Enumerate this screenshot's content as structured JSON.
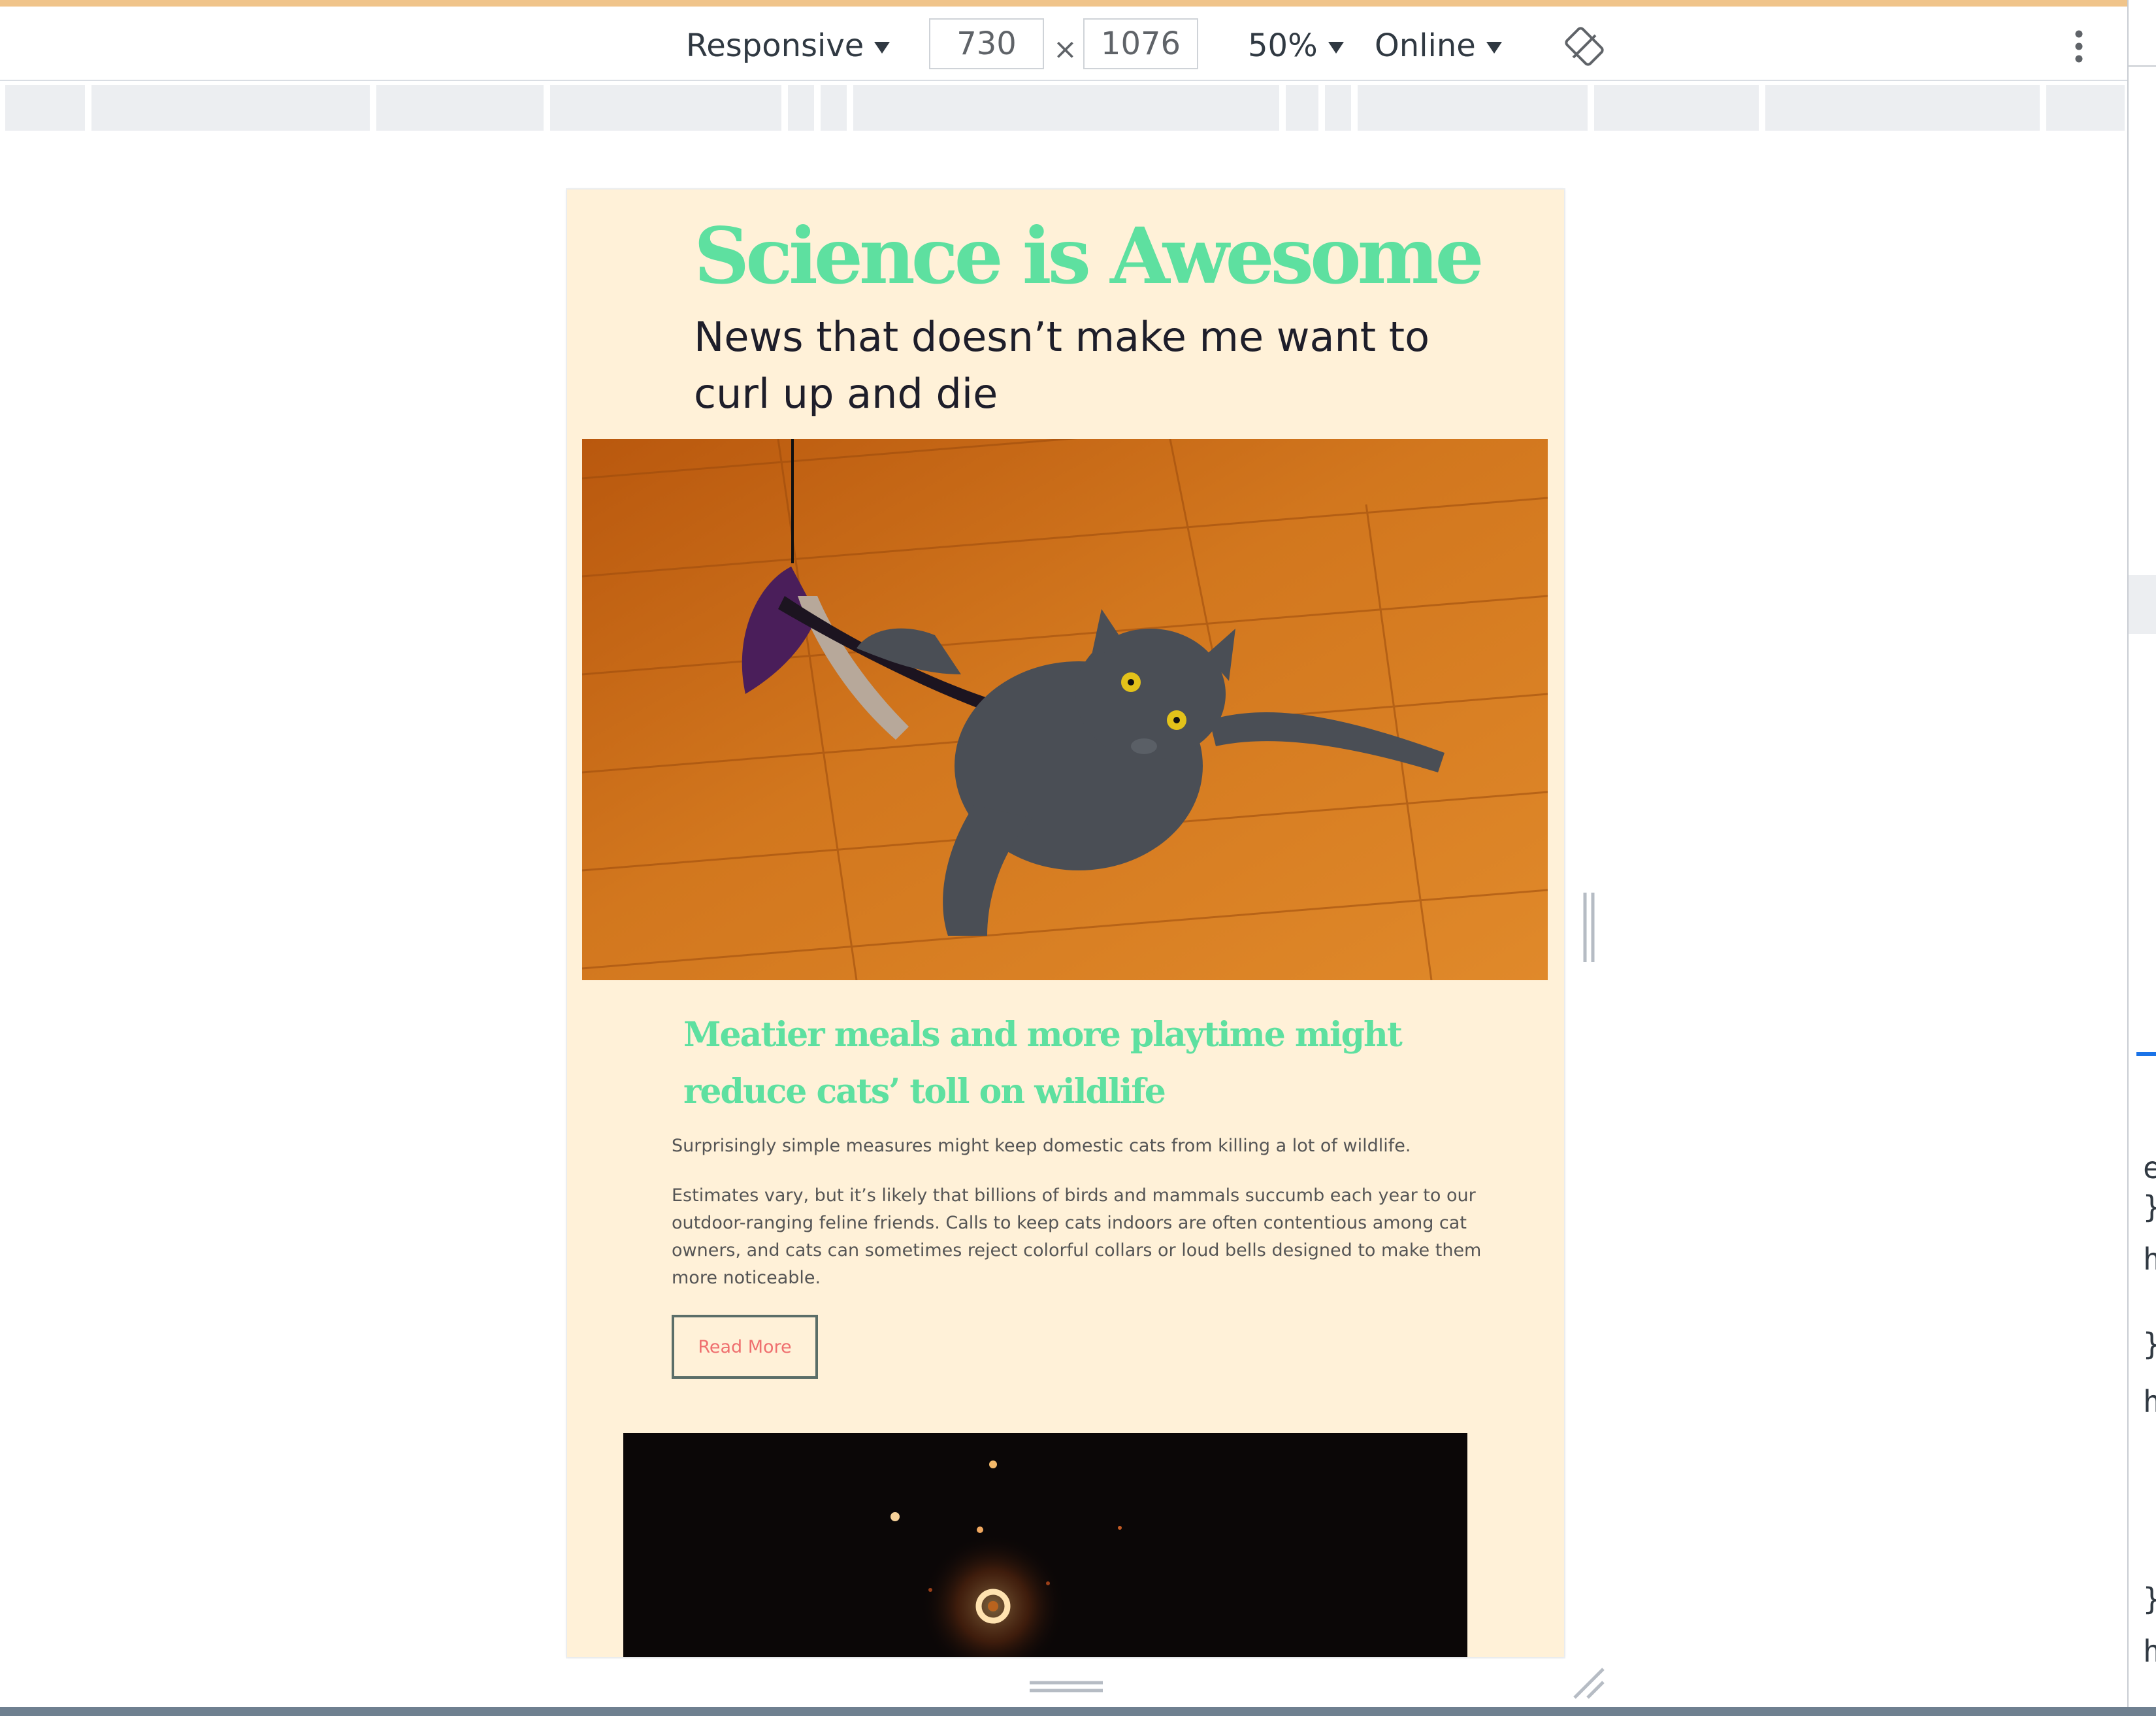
{
  "toolbar": {
    "device_label": "Responsive",
    "width_value": "730",
    "height_value": "1076",
    "times_symbol": "×",
    "zoom_label": "50%",
    "throttle_label": "Online"
  },
  "page": {
    "title": "Science is Awesome",
    "subtitle": "News that doesn’t make me want to curl up and die",
    "article": {
      "heading": "Meatier meals and more playtime might reduce cats’ toll on wildlife",
      "summary": "Surprisingly simple measures might keep domestic cats from killing a lot of wildlife.",
      "body": "Estimates vary, but it’s likely that billions of birds and mammals succumb each year to our outdoor-ranging feline friends. Calls to keep cats indoors are often contentious among cat owners, and cats can sometimes reject colorful collars or loud bells designed to make them more noticeable.",
      "button_label": "Read More"
    }
  },
  "devtools_panel": {
    "glyphs": [
      "e",
      "}",
      "h",
      "}",
      "h",
      "}",
      "h"
    ]
  },
  "colors": {
    "accent_green": "#5ee0a0",
    "page_background": "#fff1d8",
    "button_text": "#ef6f6f"
  },
  "icons": {
    "rotate": "rotate-icon",
    "more": "kebab-menu-icon"
  }
}
